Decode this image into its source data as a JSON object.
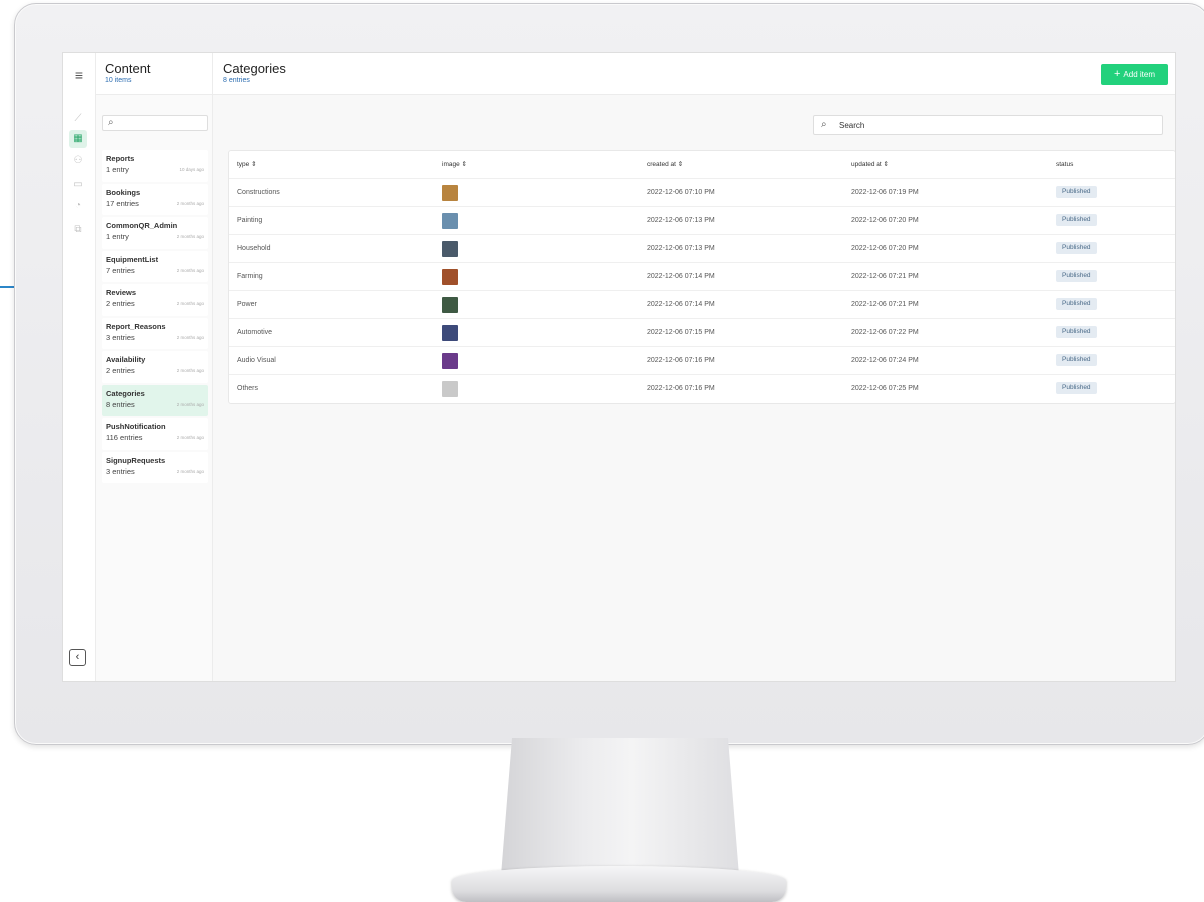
{
  "rail": {
    "menu_icon": "hamburger-menu-icon",
    "icons": [
      "chart-line-icon",
      "table-icon",
      "users-icon",
      "layout-icon",
      "bell-icon",
      "layers-icon"
    ],
    "active_index": 1,
    "collapse_icon": "chevron-left-icon"
  },
  "sidebar": {
    "title": "Content",
    "subtitle": "10 items",
    "items": [
      {
        "name": "Reports",
        "count": "1 entry",
        "ago": "10 days ago"
      },
      {
        "name": "Bookings",
        "count": "17 entries",
        "ago": "2 months ago"
      },
      {
        "name": "CommonQR_Admin",
        "count": "1 entry",
        "ago": "2 months ago"
      },
      {
        "name": "EquipmentList",
        "count": "7 entries",
        "ago": "2 months ago"
      },
      {
        "name": "Reviews",
        "count": "2 entries",
        "ago": "2 months ago"
      },
      {
        "name": "Report_Reasons",
        "count": "3 entries",
        "ago": "2 months ago"
      },
      {
        "name": "Availability",
        "count": "2 entries",
        "ago": "2 months ago"
      },
      {
        "name": "Categories",
        "count": "8 entries",
        "ago": "2 months ago"
      },
      {
        "name": "PushNotification",
        "count": "116 entries",
        "ago": "2 months ago"
      },
      {
        "name": "SignupRequests",
        "count": "3 entries",
        "ago": "2 months ago"
      }
    ],
    "active_index": 7
  },
  "main": {
    "title": "Categories",
    "subtitle": "8 entries",
    "add_button": "Add item",
    "search_placeholder": "Search"
  },
  "table": {
    "columns": [
      "type ⇕",
      "image ⇕",
      "created at ⇕",
      "updated at ⇕",
      "status"
    ],
    "rows": [
      {
        "type": "Constructions",
        "image_color": "#b8843f",
        "created": "2022-12-06 07:10 PM",
        "updated": "2022-12-06 07:19 PM",
        "status": "Published"
      },
      {
        "type": "Painting",
        "image_color": "#6a8fae",
        "created": "2022-12-06 07:13 PM",
        "updated": "2022-12-06 07:20 PM",
        "status": "Published"
      },
      {
        "type": "Household",
        "image_color": "#4a5a6a",
        "created": "2022-12-06 07:13 PM",
        "updated": "2022-12-06 07:20 PM",
        "status": "Published"
      },
      {
        "type": "Farming",
        "image_color": "#a0502a",
        "created": "2022-12-06 07:14 PM",
        "updated": "2022-12-06 07:21 PM",
        "status": "Published"
      },
      {
        "type": "Power",
        "image_color": "#3f5a44",
        "created": "2022-12-06 07:14 PM",
        "updated": "2022-12-06 07:21 PM",
        "status": "Published"
      },
      {
        "type": "Automotive",
        "image_color": "#3d4a7a",
        "created": "2022-12-06 07:15 PM",
        "updated": "2022-12-06 07:22 PM",
        "status": "Published"
      },
      {
        "type": "Audio Visual",
        "image_color": "#6a3a8a",
        "created": "2022-12-06 07:16 PM",
        "updated": "2022-12-06 07:24 PM",
        "status": "Published"
      },
      {
        "type": "Others",
        "image_color": "#c9c9c9",
        "created": "2022-12-06 07:16 PM",
        "updated": "2022-12-06 07:25 PM",
        "status": "Published"
      }
    ]
  },
  "colors": {
    "accent": "#22d17c",
    "active_bg": "#e1f5eb",
    "badge_bg": "#e4ebf2",
    "link": "#2b6cb0"
  }
}
